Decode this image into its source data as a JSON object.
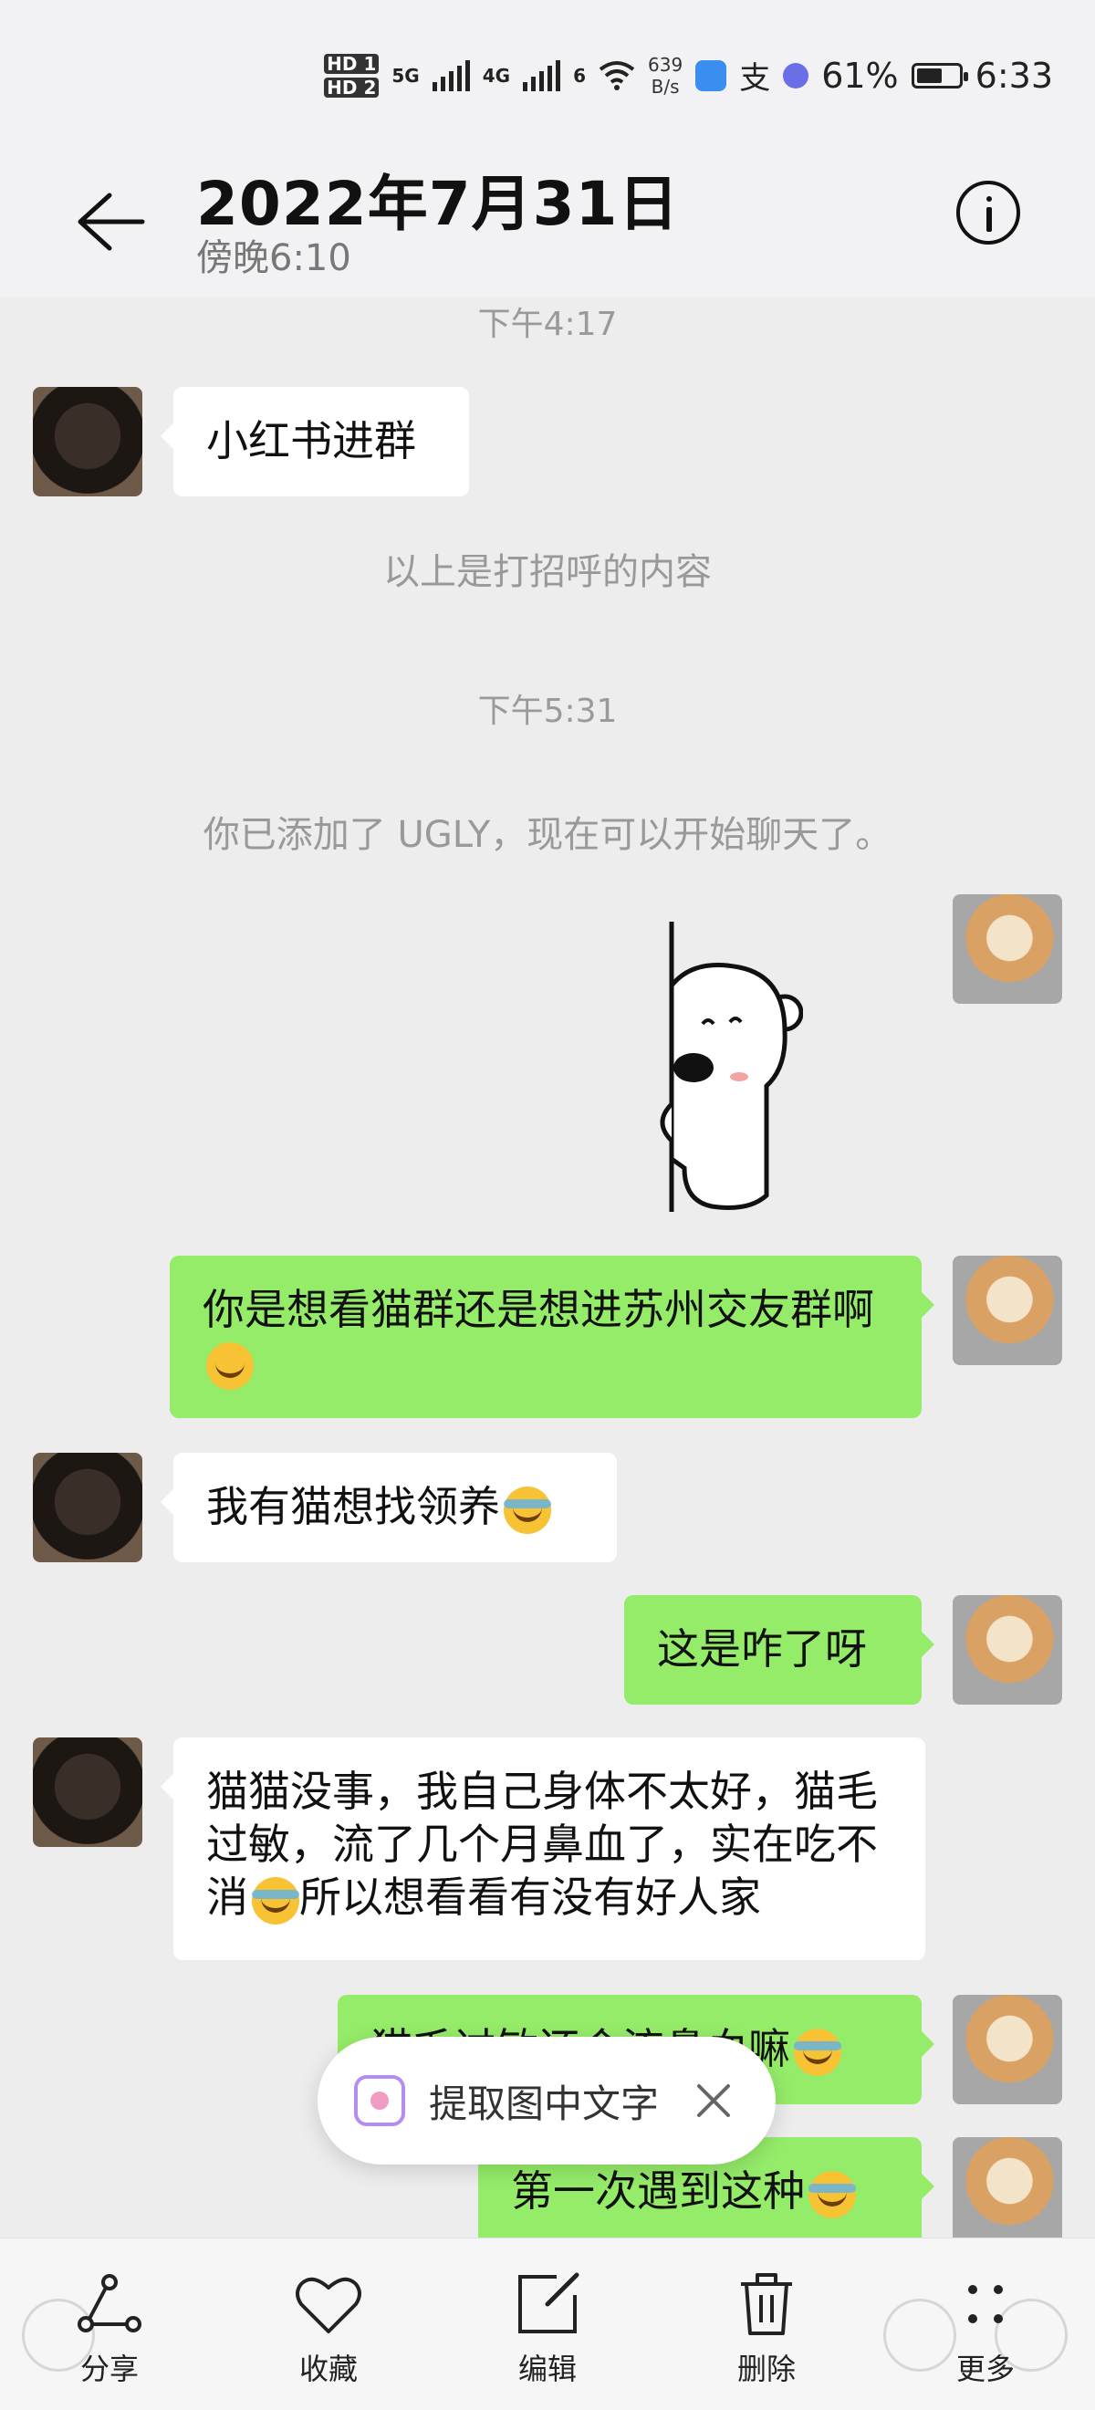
{
  "status_bar": {
    "hd1": "HD 1",
    "hd2": "HD 2",
    "net1": "5G",
    "net2": "4G",
    "wifi_tag": "6",
    "speed_value": "639",
    "speed_unit": "B/s",
    "alipay": "支",
    "battery": "61%",
    "battery_level": 0.61,
    "time": "6:33"
  },
  "header": {
    "title": "2022年7月31日",
    "subtitle": "傍晚6:10"
  },
  "chat": {
    "time1": "下午4:17",
    "msg1": "小红书进群",
    "greeting_note": "以上是打招呼的内容",
    "time2": "下午5:31",
    "added_note": "你已添加了 UGLY，现在可以开始聊天了。",
    "msg2": "你是想看猫群还是想进苏州交友群啊",
    "msg3": "我有猫想找领养",
    "msg4": "这是咋了呀",
    "msg5": "猫猫没事，我自己身体不太好，猫毛过敏，流了几个月鼻血了，实在吃不消",
    "msg5b": "所以想看看有没有好人家",
    "msg6": "猫毛过敏还会流鼻血嘛",
    "msg7": "第一次遇到这种"
  },
  "toast": {
    "label": "提取图中文字"
  },
  "bottom_bar": {
    "share": "分享",
    "favorite": "收藏",
    "edit": "编辑",
    "delete": "删除",
    "more": "更多"
  }
}
